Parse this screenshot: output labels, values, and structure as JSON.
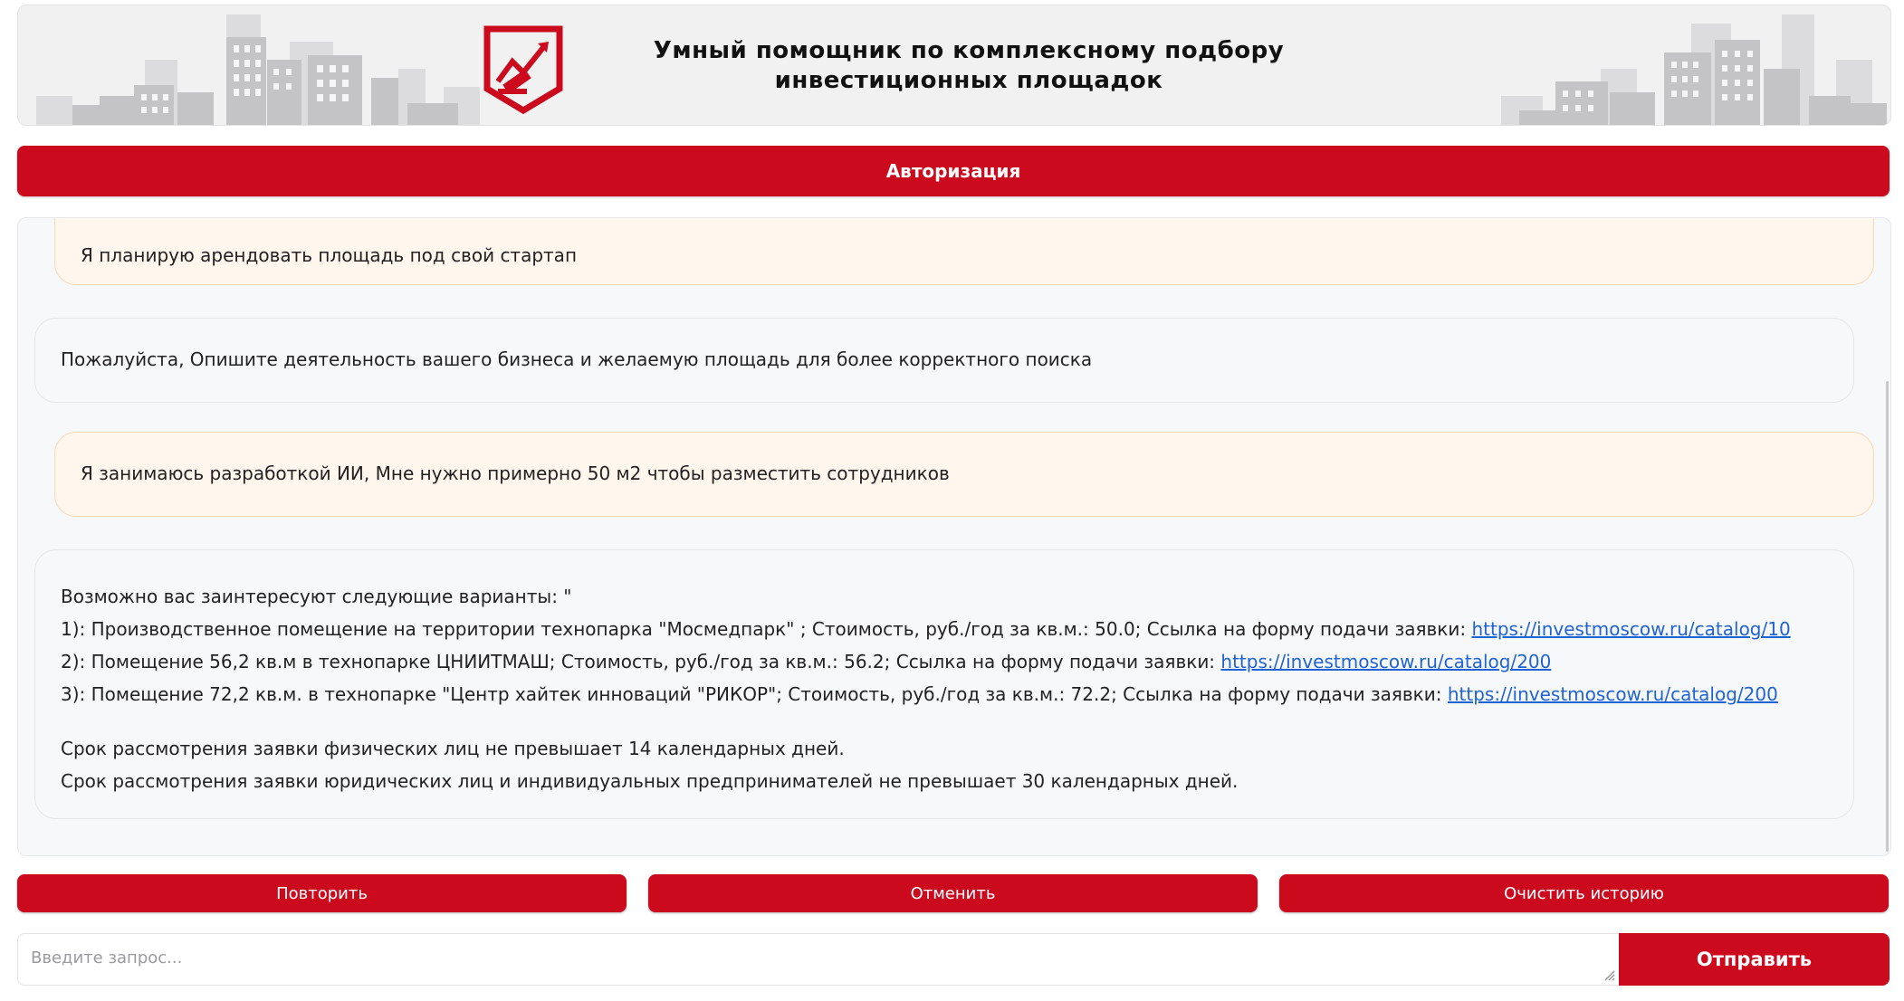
{
  "header": {
    "title_line1": "Умный помощник по комплексному подбору",
    "title_line2": "инвестиционных площадок",
    "logo_icon": "investment-logo-icon",
    "brand_color": "#cc0a1e"
  },
  "auth": {
    "label": "Авторизация"
  },
  "chat": {
    "messages": [
      {
        "role": "user",
        "text": "Я планирую арендовать площадь под свой стартап"
      },
      {
        "role": "assistant",
        "text": "Пожалуйста, Опишите деятельность вашего бизнеса и желаемую площадь для более корректного поиска"
      },
      {
        "role": "user",
        "text": "Я занимаюсь разработкой ИИ, Мне нужно примерно 50 м2 чтобы разместить сотрудников"
      },
      {
        "role": "assistant",
        "intro": "Возможно вас заинтересуют следующие варианты: \"",
        "options": [
          {
            "text": "1): Производственное помещение на территории технопарка \"Мосмедпарк\" ; Стоимость, руб./год за кв.м.: 50.0; Ссылка на форму подачи заявки: ",
            "link": "https://investmoscow.ru/catalog/10"
          },
          {
            "text": "2): Помещение 56,2 кв.м в технопарке ЦНИИТМАШ; Стоимость, руб./год за кв.м.: 56.2; Ссылка на форму подачи заявки: ",
            "link": "https://investmoscow.ru/catalog/200"
          },
          {
            "text": "3): Помещение 72,2 кв.м. в технопарке \"Центр хайтек инноваций \"РИКОР\"; Стоимость, руб./год за кв.м.: 72.2; Ссылка на форму подачи заявки: ",
            "link": "https://investmoscow.ru/catalog/200"
          }
        ],
        "note1": "Срок рассмотрения заявки физических лиц не превышает 14 календарных дней.",
        "note2": "Срок рассмотрения заявки юридических лиц и индивидуальных предпринимателей не превышает 30 календарных дней."
      }
    ]
  },
  "actions": {
    "retry": "Повторить",
    "cancel": "Отменить",
    "clear": "Очистить историю"
  },
  "composer": {
    "placeholder": "Введите запрос...",
    "value": "",
    "send_label": "Отправить"
  }
}
